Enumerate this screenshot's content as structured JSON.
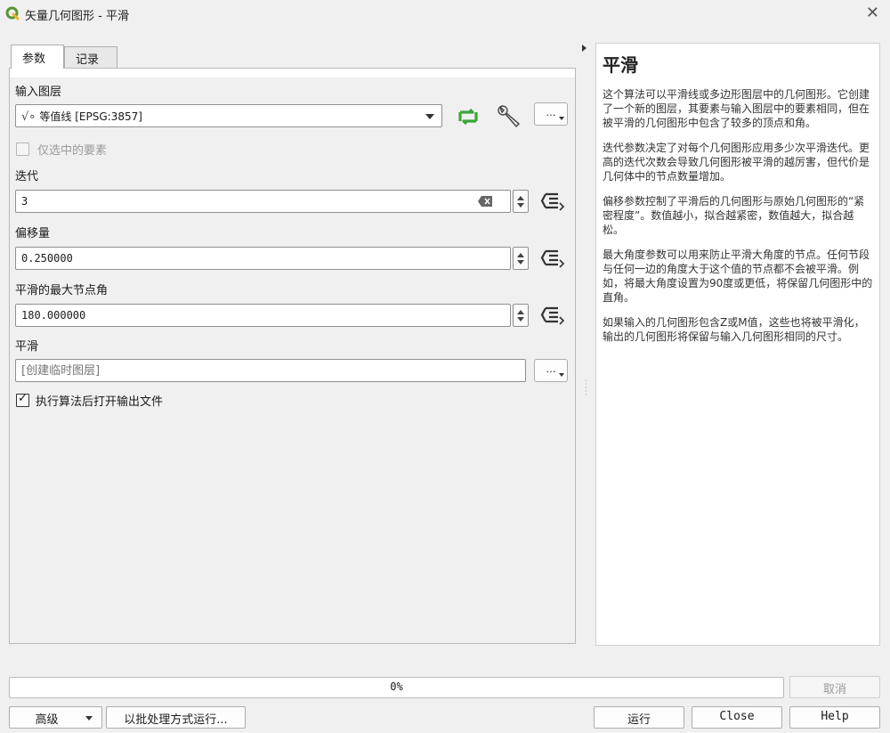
{
  "window": {
    "title": "矢量几何图形 - 平滑",
    "close_glyph": "✕",
    "accent": "#589632"
  },
  "tabs": [
    {
      "label": "参数"
    },
    {
      "label": "记录"
    }
  ],
  "params": {
    "input_layer_label": "输入图层",
    "input_layer_value": "等值线 [EPSG:3857]",
    "selected_only_label": "仅选中的要素",
    "iterations_label": "迭代",
    "iterations_value": "3",
    "offset_label": "偏移量",
    "offset_value": "0.250000",
    "max_angle_label": "平滑的最大节点角",
    "max_angle_value": "180.000000",
    "output_label": "平滑",
    "output_placeholder": "[创建临时图层]",
    "open_output_label": "执行算法后打开输出文件",
    "open_output_checked": true,
    "more_button_label": "…"
  },
  "help": {
    "title": "平滑",
    "paragraphs": [
      "这个算法可以平滑线或多边形图层中的几何图形。它创建了一个新的图层，其要素与输入图层中的要素相同，但在被平滑的几何图形中包含了较多的顶点和角。",
      "迭代参数决定了对每个几何图形应用多少次平滑迭代。更高的迭代次数会导致几何图形被平滑的越厉害，但代价是几何体中的节点数量增加。",
      "偏移参数控制了平滑后的几何图形与原始几何图形的“紧密程度”。数值越小，拟合越紧密，数值越大，拟合越松。",
      "最大角度参数可以用来防止平滑大角度的节点。任何节段与任何一边的角度大于这个值的节点都不会被平滑。例如，将最大角度设置为90度或更低，将保留几何图形中的直角。",
      "如果输入的几何图形包含Z或M值，这些也将被平滑化，输出的几何图形将保留与输入几何图形相同的尺寸。"
    ]
  },
  "footer": {
    "progress_text": "0%",
    "progress_value": 0,
    "cancel_label": "取消",
    "advanced_label": "高级",
    "batch_label": "以批处理方式运行...",
    "run_label": "运行",
    "close_label": "Close",
    "help_label": "Help"
  }
}
